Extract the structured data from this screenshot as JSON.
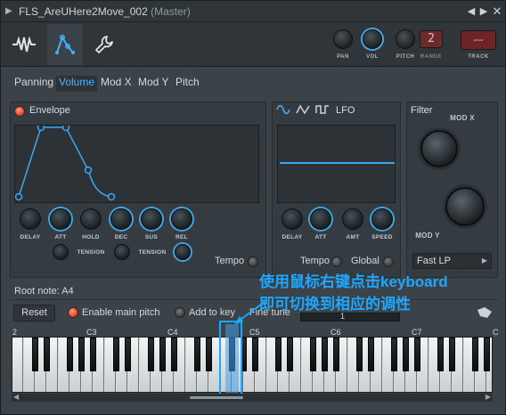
{
  "window": {
    "title_main": "FLS_AreUHere2Move_002",
    "title_sub": "(Master)"
  },
  "header": {
    "knobs": [
      {
        "label": "PAN"
      },
      {
        "label": "VOL"
      },
      {
        "label": "PITCH"
      }
    ],
    "range_label": "RANGE",
    "range_value": "2",
    "track_label": "TRACK",
    "track_value": "---"
  },
  "tabs": [
    "Panning",
    "Volume",
    "Mod X",
    "Mod Y",
    "Pitch"
  ],
  "envelope": {
    "title": "Envelope",
    "knobs": [
      "DELAY",
      "ATT",
      "HOLD",
      "DEC",
      "SUS",
      "REL"
    ],
    "tension_labels": [
      "TENSION",
      "TENSION"
    ],
    "tempo_label": "Tempo"
  },
  "lfo": {
    "title": "LFO",
    "knobs": [
      "DELAY",
      "ATT",
      "AMT",
      "SPEED"
    ],
    "tempo_label": "Tempo",
    "global_label": "Global"
  },
  "filter": {
    "title": "Filter",
    "mod_x_label": "MOD X",
    "mod_y_label": "MOD Y",
    "type_value": "Fast LP"
  },
  "root_note": {
    "label": "Root note: A4"
  },
  "controls": {
    "reset_label": "Reset",
    "enable_main_pitch": "Enable main pitch",
    "add_to_key": "Add to key",
    "fine_tune": "Fine tune",
    "fine_tune_value": "1"
  },
  "keyboard": {
    "octave_labels": [
      "2",
      "C3",
      "C4",
      "C5",
      "C6",
      "C7",
      "C"
    ]
  },
  "annotation": {
    "line1": "使用鼠标右键点击keyboard",
    "line2": "即可切换到相应的调性"
  },
  "colors": {
    "accent": "#43b0ff",
    "led_on": "#e0532f",
    "track_red": "#6e2326"
  }
}
